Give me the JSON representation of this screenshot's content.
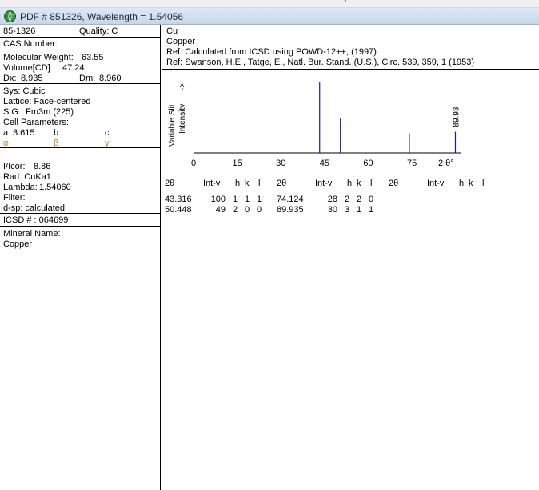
{
  "window": {
    "title": "PDF # 851326,  Wavelength = 1.54056"
  },
  "left_panel": {
    "pdf_number": "85-1326",
    "quality": "Quality: C",
    "cas_number": "CAS Number:",
    "molecular_weight_label": "Molecular Weight:",
    "molecular_weight_value": "63.55",
    "volume_label": "Volume[CD]:",
    "volume_value": "47.24",
    "dx_label": "Dx:",
    "dx_value": "8.935",
    "dm_label": "Dm:",
    "dm_value": "8.960",
    "sys": "Sys: Cubic",
    "lattice": "Lattice: Face-centered",
    "space_group": "S.G.: Fm3m (225)",
    "cell_parameters": "Cell Parameters:",
    "cell_a_label": "a",
    "cell_a_value": "3.615",
    "cell_b_label": "b",
    "cell_c_label": "c",
    "alpha": "α",
    "beta": "β",
    "gamma": "γ",
    "i_icor_label": "I/Icor:",
    "i_icor_value": "8.86",
    "rad": "Rad: CuKa1",
    "lambda_label": "Lambda:",
    "lambda_value": "1.54060",
    "filter": "Filter:",
    "d_sp": "d-sp: calculated",
    "icsd": "ICSD # : 064699",
    "mineral_name_label": "Mineral Name:",
    "mineral_name": "Copper"
  },
  "right_panel": {
    "formula": "Cu",
    "name": "Copper",
    "ref1": "Ref:  Calculated from ICSD using POWD-12++, (1997)",
    "ref2": "Ref: Swanson, H.E., Tatge, E., Natl. Bur. Stand. (U.S.), Circ. 539, 359, 1 (1953)"
  },
  "chart_data": {
    "type": "bar",
    "ylabel_line1": "Variable Slit",
    "ylabel_line2": "Intensity",
    "arrow": "->",
    "xlabel": "2 θ°",
    "x_ticks": [
      "0",
      "15",
      "30",
      "45",
      "60",
      "75"
    ],
    "xlim": [
      0,
      92
    ],
    "ylim": [
      0,
      100
    ],
    "peaks": [
      {
        "x": 43.316,
        "y": 100
      },
      {
        "x": 50.448,
        "y": 49
      },
      {
        "x": 74.124,
        "y": 28
      },
      {
        "x": 89.935,
        "y": 30
      }
    ],
    "annotation": "89.93",
    "colors": {
      "peak": "#1a1aa6",
      "axis": "#000000"
    }
  },
  "table": {
    "headers": [
      "2θ",
      "Int-v",
      "h",
      "k",
      "l"
    ],
    "columns": [
      {
        "rows": [
          {
            "two_theta": "43.316",
            "int": "100",
            "h": "1",
            "k": "1",
            "l": "1"
          },
          {
            "two_theta": "50.448",
            "int": "49",
            "h": "2",
            "k": "0",
            "l": "0"
          }
        ]
      },
      {
        "rows": [
          {
            "two_theta": "74.124",
            "int": "28",
            "h": "2",
            "k": "2",
            "l": "0"
          },
          {
            "two_theta": "89.935",
            "int": "30",
            "h": "3",
            "k": "1",
            "l": "1"
          }
        ]
      },
      {
        "rows": []
      }
    ]
  }
}
